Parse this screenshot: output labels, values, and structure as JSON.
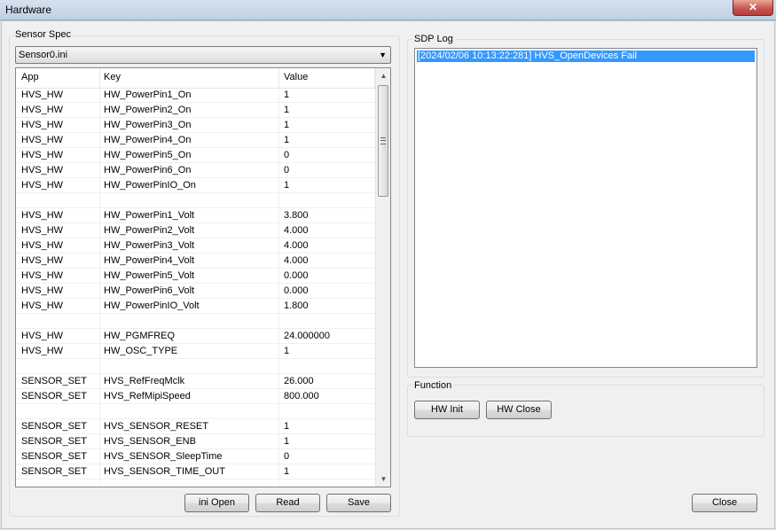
{
  "window": {
    "title": "Hardware",
    "close_glyph": "✕"
  },
  "sensor_spec": {
    "group_label": "Sensor Spec",
    "selected_file": "Sensor0.ini",
    "columns": [
      "App",
      "Key",
      "Value"
    ],
    "rows": [
      {
        "app": "HVS_HW",
        "key": "HW_PowerPin1_On",
        "value": "1"
      },
      {
        "app": "HVS_HW",
        "key": "HW_PowerPin2_On",
        "value": "1"
      },
      {
        "app": "HVS_HW",
        "key": "HW_PowerPin3_On",
        "value": "1"
      },
      {
        "app": "HVS_HW",
        "key": "HW_PowerPin4_On",
        "value": "1"
      },
      {
        "app": "HVS_HW",
        "key": "HW_PowerPin5_On",
        "value": "0"
      },
      {
        "app": "HVS_HW",
        "key": "HW_PowerPin6_On",
        "value": "0"
      },
      {
        "app": "HVS_HW",
        "key": "HW_PowerPinIO_On",
        "value": "1"
      },
      {
        "app": "",
        "key": "",
        "value": ""
      },
      {
        "app": "HVS_HW",
        "key": "HW_PowerPin1_Volt",
        "value": "3.800"
      },
      {
        "app": "HVS_HW",
        "key": "HW_PowerPin2_Volt",
        "value": "4.000"
      },
      {
        "app": "HVS_HW",
        "key": "HW_PowerPin3_Volt",
        "value": "4.000"
      },
      {
        "app": "HVS_HW",
        "key": "HW_PowerPin4_Volt",
        "value": "4.000"
      },
      {
        "app": "HVS_HW",
        "key": "HW_PowerPin5_Volt",
        "value": "0.000"
      },
      {
        "app": "HVS_HW",
        "key": "HW_PowerPin6_Volt",
        "value": "0.000"
      },
      {
        "app": "HVS_HW",
        "key": "HW_PowerPinIO_Volt",
        "value": "1.800"
      },
      {
        "app": "",
        "key": "",
        "value": ""
      },
      {
        "app": "HVS_HW",
        "key": "HW_PGMFREQ",
        "value": "24.000000"
      },
      {
        "app": "HVS_HW",
        "key": "HW_OSC_TYPE",
        "value": "1"
      },
      {
        "app": "",
        "key": "",
        "value": ""
      },
      {
        "app": "SENSOR_SET",
        "key": "HVS_RefFreqMclk",
        "value": "26.000"
      },
      {
        "app": "SENSOR_SET",
        "key": "HVS_RefMipiSpeed",
        "value": "800.000"
      },
      {
        "app": "",
        "key": "",
        "value": ""
      },
      {
        "app": "SENSOR_SET",
        "key": "HVS_SENSOR_RESET",
        "value": "1"
      },
      {
        "app": "SENSOR_SET",
        "key": "HVS_SENSOR_ENB",
        "value": "1"
      },
      {
        "app": "SENSOR_SET",
        "key": "HVS_SENSOR_SleepTime",
        "value": "0"
      },
      {
        "app": "SENSOR_SET",
        "key": "HVS_SENSOR_TIME_OUT",
        "value": "1"
      }
    ],
    "buttons": {
      "ini_open": "ini Open",
      "read": "Read",
      "save": "Save"
    }
  },
  "sdp_log": {
    "group_label": "SDP Log",
    "entries": [
      "[2024/02/06 10:13:22:281] HVS_OpenDevices Fail"
    ]
  },
  "function": {
    "group_label": "Function",
    "buttons": {
      "hw_init": "HW Init",
      "hw_close": "HW Close"
    }
  },
  "footer": {
    "close_label": "Close"
  },
  "icons": {
    "dropdown": "chevron-down-icon",
    "scroll_up": "scroll-up-icon",
    "scroll_down": "scroll-down-icon",
    "close": "close-icon"
  },
  "colors": {
    "selection": "#3399ff",
    "close_button": "#c75050"
  }
}
